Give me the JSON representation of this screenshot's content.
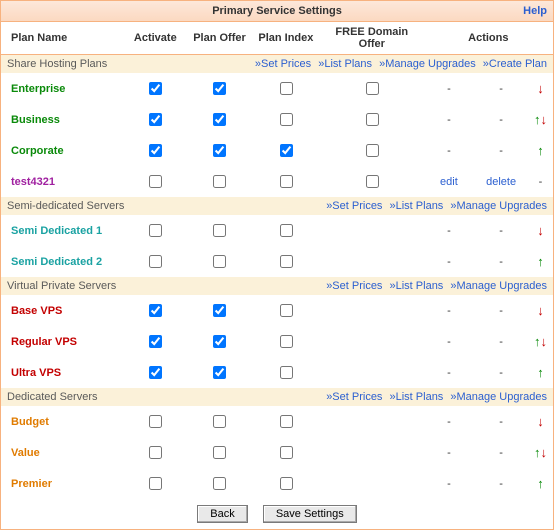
{
  "title": "Primary Service Settings",
  "help_label": "Help",
  "columns": {
    "plan": "Plan Name",
    "activate": "Activate",
    "offer": "Plan Offer",
    "index": "Plan Index",
    "free": "FREE Domain Offer",
    "actions": "Actions"
  },
  "section_links": {
    "set_prices": "»Set Prices",
    "list_plans": "»List Plans",
    "manage_upgrades": "»Manage Upgrades",
    "create_plan": "»Create Plan"
  },
  "row_action_labels": {
    "edit": "edit",
    "delete": "delete",
    "dash": "-"
  },
  "buttons": {
    "back": "Back",
    "save": "Save Settings"
  },
  "sections": [
    {
      "id": "shared",
      "title": "Share Hosting Plans",
      "show_create": true,
      "rows": [
        {
          "id": "enterprise",
          "name": "Enterprise",
          "color": "c-green",
          "activate": true,
          "offer": true,
          "index": false,
          "free": false,
          "editable": false,
          "arrows": "down"
        },
        {
          "id": "business",
          "name": "Business",
          "color": "c-green",
          "activate": true,
          "offer": true,
          "index": false,
          "free": false,
          "editable": false,
          "arrows": "updown"
        },
        {
          "id": "corporate",
          "name": "Corporate",
          "color": "c-green",
          "activate": true,
          "offer": true,
          "index": true,
          "free": false,
          "editable": false,
          "arrows": "up"
        },
        {
          "id": "test4321",
          "name": "test4321",
          "color": "c-purple",
          "activate": false,
          "offer": false,
          "index": false,
          "free": false,
          "editable": true,
          "arrows": "none"
        }
      ]
    },
    {
      "id": "semi",
      "title": "Semi-dedicated Servers",
      "show_create": false,
      "rows": [
        {
          "id": "semi1",
          "name": "Semi Dedicated 1",
          "color": "c-teal",
          "activate": false,
          "offer": false,
          "index": false,
          "free": null,
          "editable": false,
          "arrows": "down"
        },
        {
          "id": "semi2",
          "name": "Semi Dedicated 2",
          "color": "c-teal",
          "activate": false,
          "offer": false,
          "index": false,
          "free": null,
          "editable": false,
          "arrows": "up"
        }
      ]
    },
    {
      "id": "vps",
      "title": "Virtual Private Servers",
      "show_create": false,
      "rows": [
        {
          "id": "basevps",
          "name": "Base VPS",
          "color": "c-red",
          "activate": true,
          "offer": true,
          "index": false,
          "free": null,
          "editable": false,
          "arrows": "down"
        },
        {
          "id": "regvps",
          "name": "Regular VPS",
          "color": "c-red",
          "activate": true,
          "offer": true,
          "index": false,
          "free": null,
          "editable": false,
          "arrows": "updown"
        },
        {
          "id": "ultravps",
          "name": "Ultra VPS",
          "color": "c-red",
          "activate": true,
          "offer": true,
          "index": false,
          "free": null,
          "editable": false,
          "arrows": "up"
        }
      ]
    },
    {
      "id": "dedicated",
      "title": "Dedicated Servers",
      "show_create": false,
      "rows": [
        {
          "id": "budget",
          "name": "Budget",
          "color": "c-orange",
          "activate": false,
          "offer": false,
          "index": false,
          "free": null,
          "editable": false,
          "arrows": "down"
        },
        {
          "id": "value",
          "name": "Value",
          "color": "c-orange",
          "activate": false,
          "offer": false,
          "index": false,
          "free": null,
          "editable": false,
          "arrows": "updown"
        },
        {
          "id": "premier",
          "name": "Premier",
          "color": "c-orange",
          "activate": false,
          "offer": false,
          "index": false,
          "free": null,
          "editable": false,
          "arrows": "up"
        }
      ]
    }
  ]
}
